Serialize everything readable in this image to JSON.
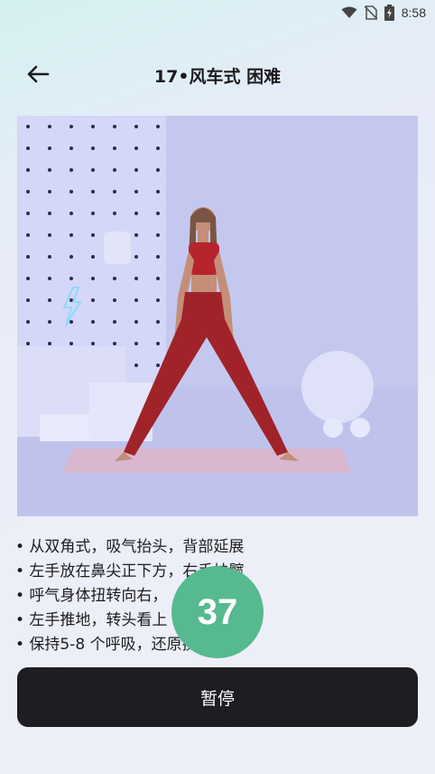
{
  "status_bar": {
    "time": "8:58",
    "icons": [
      "wifi-icon",
      "no-sim-icon",
      "battery-charging-icon"
    ]
  },
  "header": {
    "back_icon": "arrow-left-icon",
    "title": "17•风车式 困难"
  },
  "media": {
    "description_icon": "exercise-video"
  },
  "instructions": [
    "• 从双角式，吸气抬头，背部延展",
    "• 左手放在鼻尖正下方，右手扶髋",
    "• 呼气身体扭转向右，",
    "• 左手推地，转头看上",
    "• 保持5-8 个呼吸，还原换另一侧"
  ],
  "timer": {
    "value": "37"
  },
  "actions": {
    "pause_label": "暂停"
  },
  "colors": {
    "accent": "#56b98f",
    "button_bg": "#1e1d22",
    "media_bg": "#c8cdf0"
  }
}
